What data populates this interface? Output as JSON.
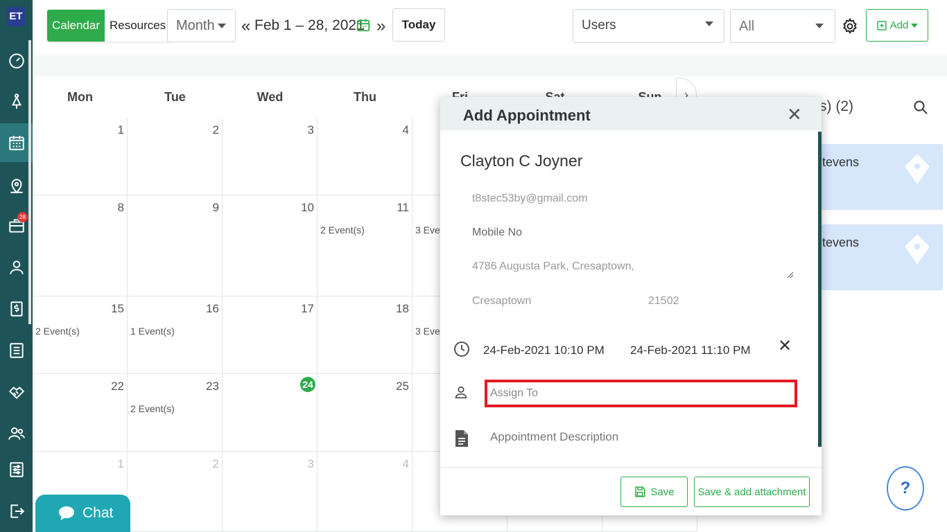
{
  "sidebar": {
    "logo": "ET",
    "notification_count": "28"
  },
  "toolbar": {
    "view_calendar": "Calendar",
    "view_resources": "Resources",
    "period_select": "Month",
    "prev": "«",
    "next": "»",
    "date_range": "Feb 1 – 28, 2021",
    "today": "Today",
    "users_select": "Users",
    "all_select": "All",
    "add_label": "Add"
  },
  "calendar": {
    "days": [
      "Mon",
      "Tue",
      "Wed",
      "Thu",
      "Fri",
      "Sat",
      "Sun"
    ],
    "weeks": [
      [
        {
          "n": "1",
          "e": ""
        },
        {
          "n": "2",
          "e": ""
        },
        {
          "n": "3",
          "e": ""
        },
        {
          "n": "4",
          "e": ""
        }
      ],
      [
        {
          "n": "8",
          "e": ""
        },
        {
          "n": "9",
          "e": ""
        },
        {
          "n": "10",
          "e": ""
        },
        {
          "n": "11",
          "e": "2 Event(s)"
        },
        {
          "n": "",
          "e": "3 Even"
        }
      ],
      [
        {
          "n": "15",
          "e": "2 Event(s)"
        },
        {
          "n": "16",
          "e": "1 Event(s)"
        },
        {
          "n": "17",
          "e": ""
        },
        {
          "n": "18",
          "e": ""
        },
        {
          "n": "",
          "e": "3 Even"
        }
      ],
      [
        {
          "n": "22",
          "e": ""
        },
        {
          "n": "23",
          "e": "2 Event(s)"
        },
        {
          "n": "24",
          "e": "",
          "today": true
        },
        {
          "n": "25",
          "e": ""
        }
      ],
      [
        {
          "n": "1",
          "e": "",
          "faded": true
        },
        {
          "n": "2",
          "e": "",
          "faded": true
        },
        {
          "n": "3",
          "e": "",
          "faded": true
        },
        {
          "n": "4",
          "e": "",
          "faded": true
        }
      ]
    ]
  },
  "right_panel": {
    "title_fragment": "s) (2)",
    "cards": [
      "tevens",
      "tevens"
    ]
  },
  "modal": {
    "title": "Add Appointment",
    "name": "Clayton C Joyner",
    "email": "t8stec53by@gmail.com",
    "mobile_placeholder": "Mobile No",
    "address": "4786  Augusta Park, Cresaptown,",
    "city": "Cresaptown",
    "zip": "21502",
    "start": "24-Feb-2021 10:10 PM",
    "end": "24-Feb-2021 11:10 PM",
    "assign_placeholder": "Assign To",
    "description_placeholder": "Appointment Description",
    "save": "Save",
    "save_attach": "Save & add attachment"
  },
  "chat": {
    "label": "Chat"
  },
  "help": {
    "label": "?"
  }
}
